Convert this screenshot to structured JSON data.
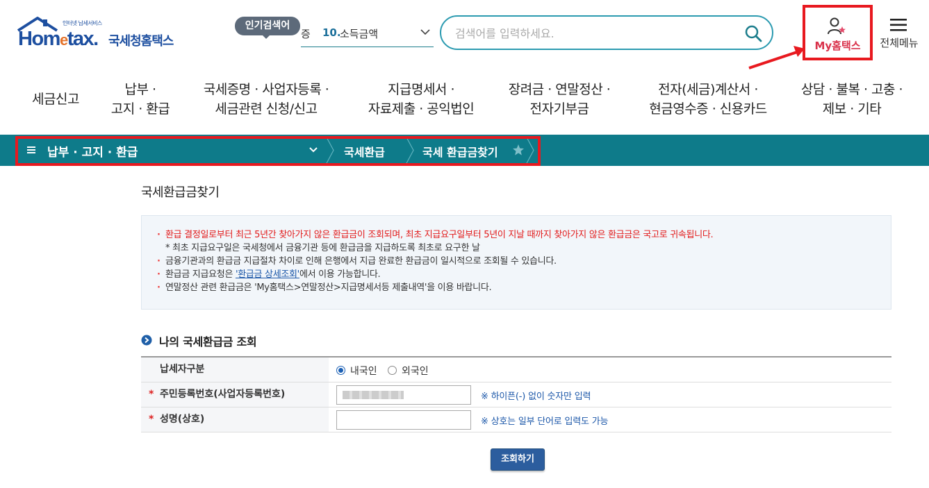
{
  "logo": {
    "tagline": "인터넷 납세서비스",
    "brand_pre": "Hom",
    "brand_e": "e",
    "brand_post": "tax.",
    "brand_kr": "국세청홈택스"
  },
  "popular_search": {
    "badge": "인기검색어",
    "prefix": "증",
    "rank": "10.",
    "term": "소득금액"
  },
  "search": {
    "placeholder": "검색어를 입력하세요."
  },
  "header_links": {
    "my_hometax": "My홈택스",
    "all_menu": "전체메뉴"
  },
  "gnb": [
    {
      "line1": "세금신고",
      "line2": ""
    },
    {
      "line1": "납부 ·",
      "line2": "고지 · 환급"
    },
    {
      "line1": "국세증명 · 사업자등록 ·",
      "line2": "세금관련 신청/신고"
    },
    {
      "line1": "지급명세서 ·",
      "line2": "자료제출 · 공익법인"
    },
    {
      "line1": "장려금 · 연말정산 ·",
      "line2": "전자기부금"
    },
    {
      "line1": "전자(세금)계산서 ·",
      "line2": "현금영수증 · 신용카드"
    },
    {
      "line1": "상담 · 불복 · 고충 ·",
      "line2": "제보 · 기타"
    }
  ],
  "breadcrumb": {
    "level1": "납부 · 고지 · 환급",
    "level2": "국세환급",
    "level3": "국세 환급금찾기"
  },
  "page": {
    "title": "국세환급금찾기"
  },
  "notice": {
    "line1": "환급 결정일로부터 최근 5년간 찾아가지 않은 환급금이 조회되며, 최초 지급요구일부터 5년이 지날 때까지 찾아가지 않은 환급금은 국고로 귀속됩니다.",
    "line1_sub": "* 최초 지급요구일은 국세청에서 금융기관 등에 환급금을 지급하도록 최초로 요구한 날",
    "line2": "금융기관과의 환급금 지급절차 차이로 인해 은행에서 지급 완료한 환급금이 일시적으로 조회될 수 있습니다.",
    "line3_pre": "환급금 지급요청은 ",
    "line3_link": "'환급금 상세조회'",
    "line3_post": "에서 이용 가능합니다.",
    "line4": "연말정산 관련 환급금은 'My홈택스>연말정산>지급명세서등 제출내역'을 이용 바랍니다."
  },
  "section": {
    "title": "나의 국세환급금 조회"
  },
  "form": {
    "taxpayer_type_label": "납세자구분",
    "option_domestic": "내국인",
    "option_foreign": "외국인",
    "selected": "내국인",
    "id_label": "주민등록번호(사업자등록번호)",
    "id_hint": "※ 하이픈(-) 없이 숫자만 입력",
    "name_label": "성명(상호)",
    "name_hint": "※ 상호는 일부 단어로 입력도 가능",
    "required_mark": "*"
  },
  "submit": {
    "label": "조회하기"
  },
  "colors": {
    "primary_teal": "#0e7b8a",
    "highlight_red": "#e8191f",
    "button_blue": "#2c5d9e",
    "notice_red": "#e21a1a"
  }
}
